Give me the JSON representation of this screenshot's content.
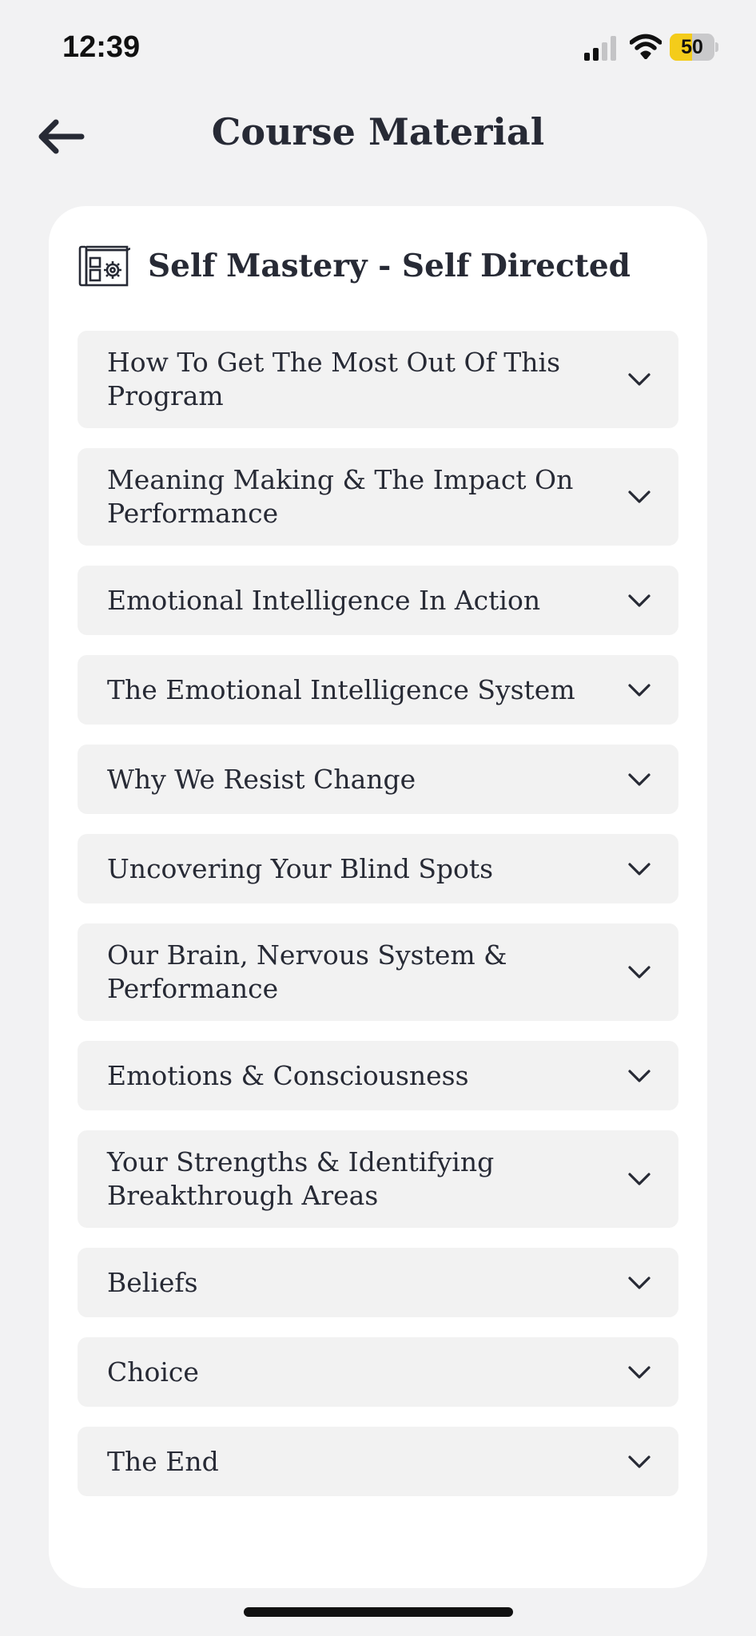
{
  "status_bar": {
    "time": "12:39",
    "battery_level": 50,
    "battery_label": "50",
    "battery_color": "#f4cc1a"
  },
  "header": {
    "back_icon": "arrow-left-icon",
    "title": "Course Material"
  },
  "course": {
    "icon": "course-blueprint-gear-icon",
    "title": "Self Mastery - Self Directed",
    "modules": [
      {
        "label": "How To Get The Most Out Of This Program"
      },
      {
        "label": "Meaning Making & The Impact On Performance"
      },
      {
        "label": "Emotional Intelligence In Action"
      },
      {
        "label": "The Emotional Intelligence System"
      },
      {
        "label": "Why We Resist Change"
      },
      {
        "label": "Uncovering Your Blind Spots"
      },
      {
        "label": "Our Brain, Nervous System & Performance"
      },
      {
        "label": "Emotions & Consciousness"
      },
      {
        "label": "Your Strengths & Identifying Breakthrough Areas"
      },
      {
        "label": "Beliefs"
      },
      {
        "label": "Choice"
      },
      {
        "label": "The End"
      }
    ]
  },
  "colors": {
    "background": "#f2f2f3",
    "card": "#ffffff",
    "module_background": "#f2f2f2",
    "text": "#272a35"
  }
}
